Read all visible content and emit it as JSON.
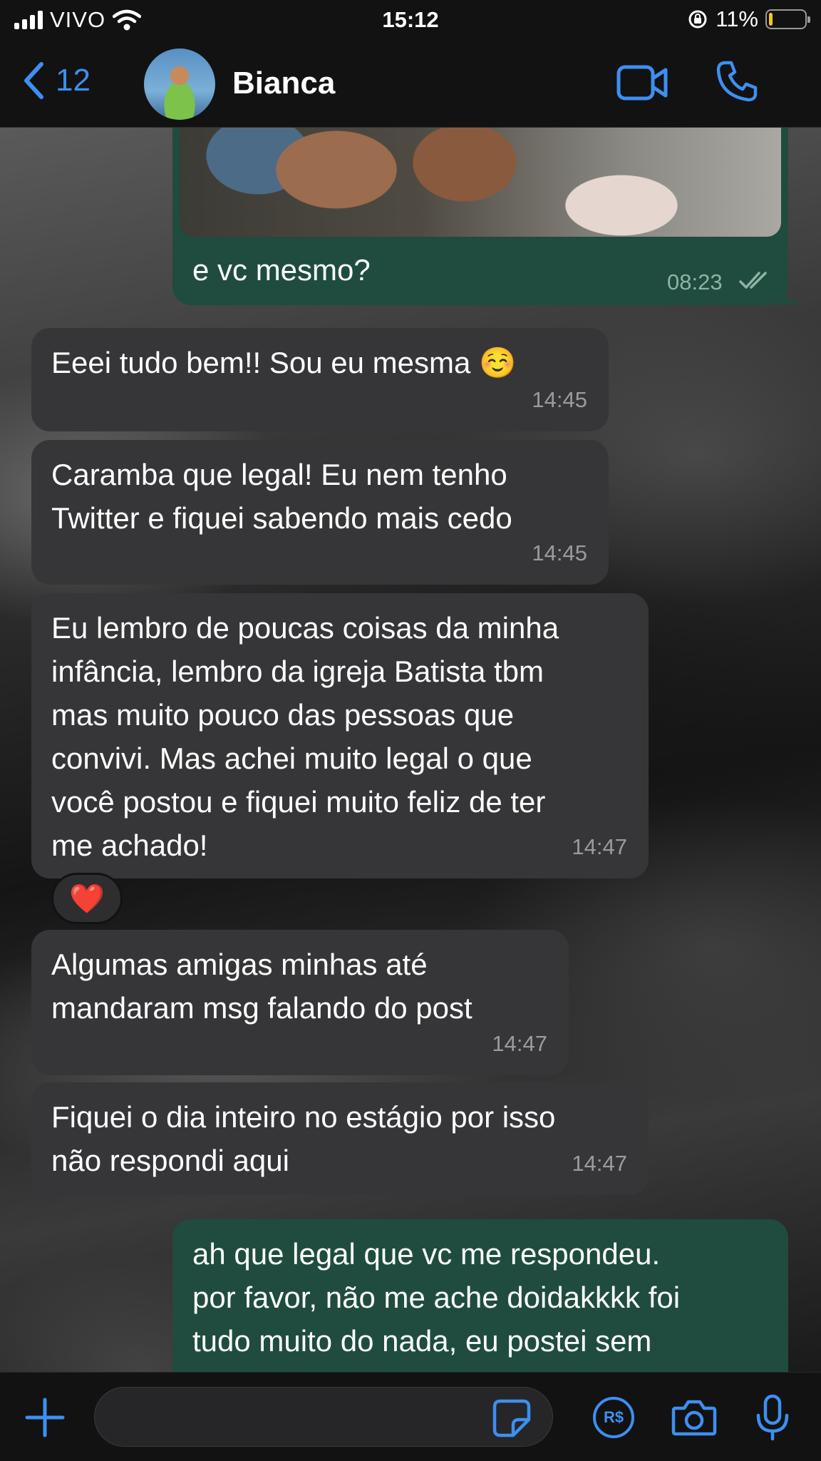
{
  "status_bar": {
    "carrier": "VIVO",
    "time": "15:12",
    "battery_percent": "11%",
    "battery_level": 0.11,
    "signal_bars": 4
  },
  "header": {
    "back_count": "12",
    "contact_name": "Bianca",
    "icons": [
      "chevron-left-icon",
      "video-call-icon",
      "phone-icon"
    ]
  },
  "messages": [
    {
      "id": "m0",
      "direction": "outgoing",
      "has_image": true,
      "text": "e vc mesmo?",
      "time": "08:23",
      "status": "read"
    },
    {
      "id": "m1",
      "direction": "incoming",
      "lines": [
        "Eeei tudo bem!! Sou eu mesma ☺️"
      ],
      "time": "14:45"
    },
    {
      "id": "m2",
      "direction": "incoming",
      "lines": [
        "Caramba que legal! Eu nem tenho",
        "Twitter e fiquei sabendo mais cedo"
      ],
      "time": "14:45"
    },
    {
      "id": "m3",
      "direction": "incoming",
      "lines": [
        "Eu lembro de poucas coisas da minha",
        "infância, lembro da igreja Batista tbm",
        "mas muito pouco das pessoas que",
        "convivi. Mas achei muito legal o que",
        "você postou e fiquei muito feliz de ter",
        "me achado!"
      ],
      "time": "14:47",
      "reaction": "❤️"
    },
    {
      "id": "m4",
      "direction": "incoming",
      "lines": [
        "Algumas amigas minhas até",
        "mandaram msg falando do post"
      ],
      "time": "14:47"
    },
    {
      "id": "m5",
      "direction": "incoming",
      "lines": [
        "Fiquei o dia inteiro no estágio por isso",
        "não respondi aqui"
      ],
      "time": "14:47"
    },
    {
      "id": "m6",
      "direction": "outgoing",
      "lines": [
        "ah que legal que vc me respondeu.",
        "por favor, não me ache doidakkkk foi",
        "tudo muito do nada, eu postei sem"
      ]
    }
  ],
  "input_bar": {
    "icons": [
      "plus-icon",
      "sticker-icon",
      "payment-icon",
      "camera-icon",
      "microphone-icon"
    ],
    "payment_label": "R$"
  },
  "colors": {
    "accent": "#3d8ff2",
    "incoming_bubble": "#363638",
    "outgoing_bubble": "#1f4c3e",
    "read_ticks": "#8fb3a5"
  }
}
